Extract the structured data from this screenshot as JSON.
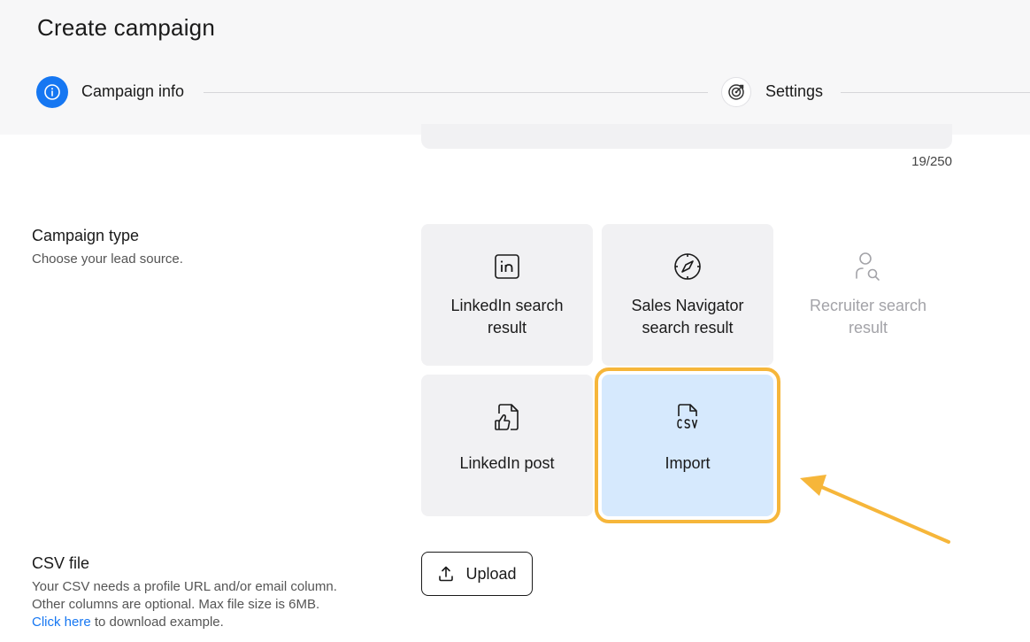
{
  "page": {
    "title": "Create campaign"
  },
  "stepper": {
    "steps": [
      {
        "label": "Campaign info",
        "icon": "info-icon",
        "state": "active"
      },
      {
        "label": "Settings",
        "icon": "target-icon",
        "state": "inactive"
      }
    ]
  },
  "name_field": {
    "char_count": "19/250"
  },
  "campaign_type": {
    "title": "Campaign type",
    "description": "Choose your lead source.",
    "options": [
      {
        "label": "LinkedIn search result",
        "icon": "linkedin-icon",
        "state": "default"
      },
      {
        "label": "Sales Navigator search result",
        "icon": "compass-icon",
        "state": "default"
      },
      {
        "label": "Recruiter search result",
        "icon": "user-search-icon",
        "state": "disabled"
      },
      {
        "label": "LinkedIn post",
        "icon": "thumbs-up-file-icon",
        "state": "default"
      },
      {
        "label": "Import",
        "icon": "csv-file-icon",
        "state": "selected"
      }
    ]
  },
  "csv_file": {
    "title": "CSV file",
    "description_line1": "Your CSV needs a profile URL and/or email column.",
    "description_line2": "Other columns are optional. Max file size is 6MB.",
    "link_text": "Click here",
    "link_suffix": " to download example.",
    "upload_label": "Upload"
  },
  "colors": {
    "accent": "#1677f2",
    "card_bg": "#f1f1f3",
    "selected_bg": "#d6e9fd",
    "highlight": "#f6b63a"
  }
}
